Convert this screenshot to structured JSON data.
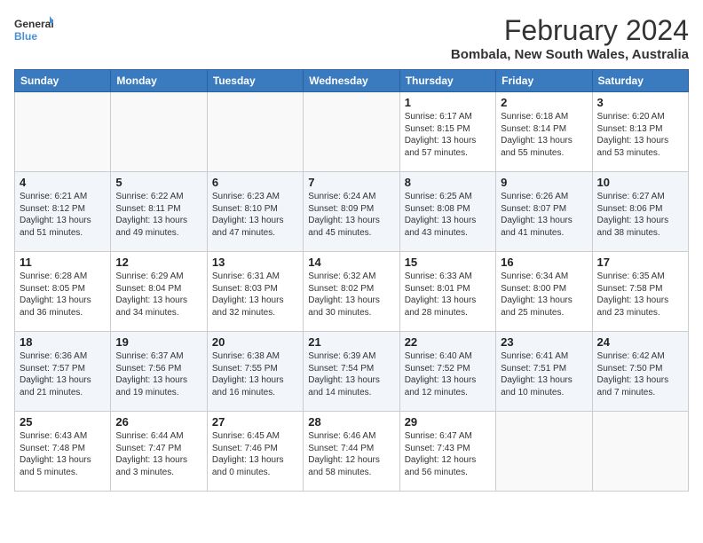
{
  "logo": {
    "line1": "General",
    "line2": "Blue"
  },
  "title": {
    "month_year": "February 2024",
    "location": "Bombala, New South Wales, Australia"
  },
  "headers": [
    "Sunday",
    "Monday",
    "Tuesday",
    "Wednesday",
    "Thursday",
    "Friday",
    "Saturday"
  ],
  "weeks": [
    [
      {
        "day": "",
        "info": ""
      },
      {
        "day": "",
        "info": ""
      },
      {
        "day": "",
        "info": ""
      },
      {
        "day": "",
        "info": ""
      },
      {
        "day": "1",
        "info": "Sunrise: 6:17 AM\nSunset: 8:15 PM\nDaylight: 13 hours\nand 57 minutes."
      },
      {
        "day": "2",
        "info": "Sunrise: 6:18 AM\nSunset: 8:14 PM\nDaylight: 13 hours\nand 55 minutes."
      },
      {
        "day": "3",
        "info": "Sunrise: 6:20 AM\nSunset: 8:13 PM\nDaylight: 13 hours\nand 53 minutes."
      }
    ],
    [
      {
        "day": "4",
        "info": "Sunrise: 6:21 AM\nSunset: 8:12 PM\nDaylight: 13 hours\nand 51 minutes."
      },
      {
        "day": "5",
        "info": "Sunrise: 6:22 AM\nSunset: 8:11 PM\nDaylight: 13 hours\nand 49 minutes."
      },
      {
        "day": "6",
        "info": "Sunrise: 6:23 AM\nSunset: 8:10 PM\nDaylight: 13 hours\nand 47 minutes."
      },
      {
        "day": "7",
        "info": "Sunrise: 6:24 AM\nSunset: 8:09 PM\nDaylight: 13 hours\nand 45 minutes."
      },
      {
        "day": "8",
        "info": "Sunrise: 6:25 AM\nSunset: 8:08 PM\nDaylight: 13 hours\nand 43 minutes."
      },
      {
        "day": "9",
        "info": "Sunrise: 6:26 AM\nSunset: 8:07 PM\nDaylight: 13 hours\nand 41 minutes."
      },
      {
        "day": "10",
        "info": "Sunrise: 6:27 AM\nSunset: 8:06 PM\nDaylight: 13 hours\nand 38 minutes."
      }
    ],
    [
      {
        "day": "11",
        "info": "Sunrise: 6:28 AM\nSunset: 8:05 PM\nDaylight: 13 hours\nand 36 minutes."
      },
      {
        "day": "12",
        "info": "Sunrise: 6:29 AM\nSunset: 8:04 PM\nDaylight: 13 hours\nand 34 minutes."
      },
      {
        "day": "13",
        "info": "Sunrise: 6:31 AM\nSunset: 8:03 PM\nDaylight: 13 hours\nand 32 minutes."
      },
      {
        "day": "14",
        "info": "Sunrise: 6:32 AM\nSunset: 8:02 PM\nDaylight: 13 hours\nand 30 minutes."
      },
      {
        "day": "15",
        "info": "Sunrise: 6:33 AM\nSunset: 8:01 PM\nDaylight: 13 hours\nand 28 minutes."
      },
      {
        "day": "16",
        "info": "Sunrise: 6:34 AM\nSunset: 8:00 PM\nDaylight: 13 hours\nand 25 minutes."
      },
      {
        "day": "17",
        "info": "Sunrise: 6:35 AM\nSunset: 7:58 PM\nDaylight: 13 hours\nand 23 minutes."
      }
    ],
    [
      {
        "day": "18",
        "info": "Sunrise: 6:36 AM\nSunset: 7:57 PM\nDaylight: 13 hours\nand 21 minutes."
      },
      {
        "day": "19",
        "info": "Sunrise: 6:37 AM\nSunset: 7:56 PM\nDaylight: 13 hours\nand 19 minutes."
      },
      {
        "day": "20",
        "info": "Sunrise: 6:38 AM\nSunset: 7:55 PM\nDaylight: 13 hours\nand 16 minutes."
      },
      {
        "day": "21",
        "info": "Sunrise: 6:39 AM\nSunset: 7:54 PM\nDaylight: 13 hours\nand 14 minutes."
      },
      {
        "day": "22",
        "info": "Sunrise: 6:40 AM\nSunset: 7:52 PM\nDaylight: 13 hours\nand 12 minutes."
      },
      {
        "day": "23",
        "info": "Sunrise: 6:41 AM\nSunset: 7:51 PM\nDaylight: 13 hours\nand 10 minutes."
      },
      {
        "day": "24",
        "info": "Sunrise: 6:42 AM\nSunset: 7:50 PM\nDaylight: 13 hours\nand 7 minutes."
      }
    ],
    [
      {
        "day": "25",
        "info": "Sunrise: 6:43 AM\nSunset: 7:48 PM\nDaylight: 13 hours\nand 5 minutes."
      },
      {
        "day": "26",
        "info": "Sunrise: 6:44 AM\nSunset: 7:47 PM\nDaylight: 13 hours\nand 3 minutes."
      },
      {
        "day": "27",
        "info": "Sunrise: 6:45 AM\nSunset: 7:46 PM\nDaylight: 13 hours\nand 0 minutes."
      },
      {
        "day": "28",
        "info": "Sunrise: 6:46 AM\nSunset: 7:44 PM\nDaylight: 12 hours\nand 58 minutes."
      },
      {
        "day": "29",
        "info": "Sunrise: 6:47 AM\nSunset: 7:43 PM\nDaylight: 12 hours\nand 56 minutes."
      },
      {
        "day": "",
        "info": ""
      },
      {
        "day": "",
        "info": ""
      }
    ]
  ]
}
